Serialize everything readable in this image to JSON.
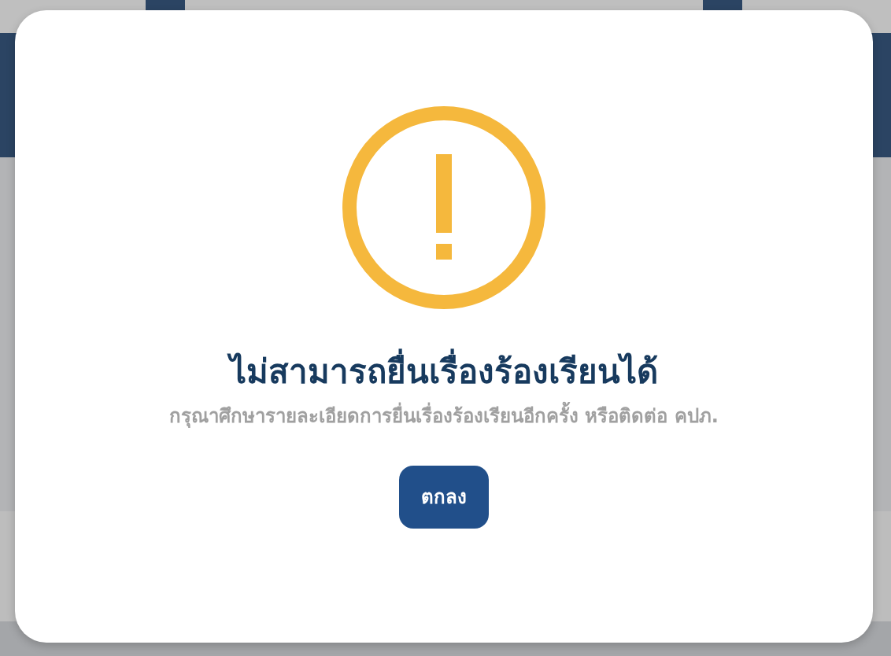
{
  "dialog": {
    "title": "ไม่สามารถยื่นเรื่องร้องเรียนได้",
    "message": "กรุณาศึกษารายละเอียดการยื่นเรื่องร้องเรียนอีกครั้ง หรือติดต่อ คปภ.",
    "buttons": [
      "ตกลง"
    ]
  }
}
